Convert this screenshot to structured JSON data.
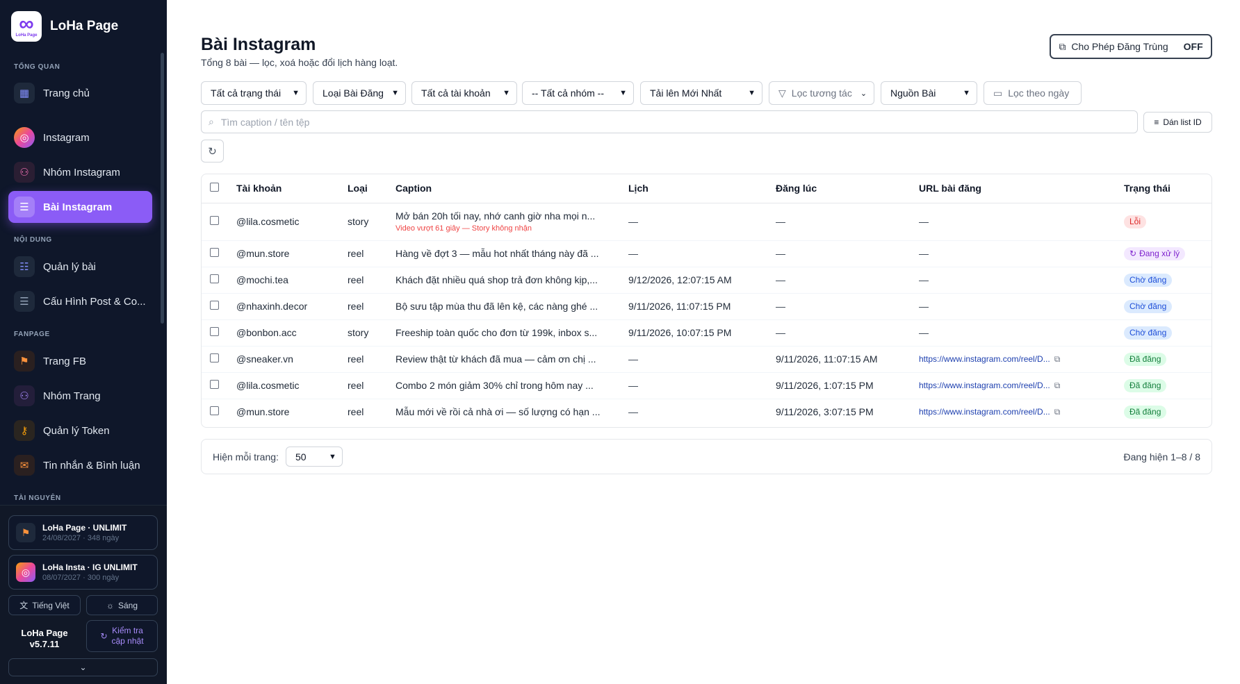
{
  "brand": {
    "name": "LoHa Page",
    "logo_text": "LoHa Page"
  },
  "sidebar": {
    "sections": {
      "overview": "TỔNG QUAN",
      "content": "NỘI DUNG",
      "fanpage": "FANPAGE",
      "resources": "TÀI NGUYÊN"
    },
    "items": [
      {
        "label": "Trang chủ",
        "icon": "grid-icon"
      },
      {
        "label": "Instagram",
        "icon": "instagram-icon"
      },
      {
        "label": "Nhóm Instagram",
        "icon": "users-icon"
      },
      {
        "label": "Bài Instagram",
        "icon": "list-icon",
        "active": true
      },
      {
        "label": "Quản lý bài",
        "icon": "checklist-icon"
      },
      {
        "label": "Cấu Hình Post & Co...",
        "icon": "sliders-icon"
      },
      {
        "label": "Trang FB",
        "icon": "flag-icon"
      },
      {
        "label": "Nhóm Trang",
        "icon": "users-icon"
      },
      {
        "label": "Quản lý Token",
        "icon": "key-icon"
      },
      {
        "label": "Tin nhắn & Bình luận",
        "icon": "chat-icon"
      }
    ],
    "licenses": [
      {
        "title": "LoHa Page · UNLIMIT",
        "sub": "24/08/2027 · 348 ngày"
      },
      {
        "title": "LoHa Insta · IG UNLIMIT",
        "sub": "08/07/2027 · 300 ngày"
      }
    ],
    "language_label": "Tiếng Việt",
    "theme_label": "Sáng",
    "version_name": "LoHa Page",
    "version_number": "v5.7.11",
    "update_label_1": "Kiểm tra",
    "update_label_2": "cập nhật"
  },
  "header": {
    "title": "Bài Instagram",
    "subtitle": "Tổng 8 bài — lọc, xoá hoặc đổi lịch hàng loạt.",
    "dup_label": "Cho Phép Đăng Trùng",
    "dup_state": "OFF"
  },
  "filters": {
    "status": "Tất cả trạng thái",
    "post_type": "Loại Bài Đăng",
    "account": "Tất cả tài khoản",
    "group": "-- Tất cả nhóm --",
    "sort": "Tải lên Mới Nhất",
    "interaction": "Lọc tương tác",
    "source": "Nguồn Bài",
    "date": "Lọc theo ngày"
  },
  "search": {
    "placeholder": "Tìm caption / tên tệp",
    "paste_label": "Dán list ID"
  },
  "table": {
    "headers": [
      "Tài khoản",
      "Loại",
      "Caption",
      "Lịch",
      "Đăng lúc",
      "URL bài đăng",
      "Trạng thái"
    ],
    "rows": [
      {
        "account": "@lila.cosmetic",
        "type": "story",
        "caption": "Mở bán 20h tối nay, nhớ canh giờ nha mọi n...",
        "error": "Video vượt 61 giây — Story không nhận",
        "schedule": "—",
        "posted": "—",
        "url": "—",
        "status": "Lỗi",
        "status_kind": "error"
      },
      {
        "account": "@mun.store",
        "type": "reel",
        "caption": "Hàng về đợt 3 — mẫu hot nhất tháng này đã ...",
        "schedule": "—",
        "posted": "—",
        "url": "—",
        "status": "Đang xử lý",
        "status_kind": "proc"
      },
      {
        "account": "@mochi.tea",
        "type": "reel",
        "caption": "Khách đặt nhiều quá shop trả đơn không kịp,...",
        "schedule": "9/12/2026, 12:07:15 AM",
        "posted": "—",
        "url": "—",
        "status": "Chờ đăng",
        "status_kind": "wait"
      },
      {
        "account": "@nhaxinh.decor",
        "type": "reel",
        "caption": "Bộ sưu tập mùa thu đã lên kệ, các nàng ghé ...",
        "schedule": "9/11/2026, 11:07:15 PM",
        "posted": "—",
        "url": "—",
        "status": "Chờ đăng",
        "status_kind": "wait"
      },
      {
        "account": "@bonbon.acc",
        "type": "story",
        "caption": "Freeship toàn quốc cho đơn từ 199k, inbox s...",
        "schedule": "9/11/2026, 10:07:15 PM",
        "posted": "—",
        "url": "—",
        "status": "Chờ đăng",
        "status_kind": "wait"
      },
      {
        "account": "@sneaker.vn",
        "type": "reel",
        "caption": "Review thật từ khách đã mua — cảm ơn chị ...",
        "schedule": "—",
        "posted": "9/11/2026, 11:07:15 AM",
        "url": "https://www.instagram.com/reel/D...",
        "status": "Đã đăng",
        "status_kind": "done"
      },
      {
        "account": "@lila.cosmetic",
        "type": "reel",
        "caption": "Combo 2 món giảm 30% chỉ trong hôm nay ...",
        "schedule": "—",
        "posted": "9/11/2026, 1:07:15 PM",
        "url": "https://www.instagram.com/reel/D...",
        "status": "Đã đăng",
        "status_kind": "done"
      },
      {
        "account": "@mun.store",
        "type": "reel",
        "caption": "Mẫu mới về rồi cả nhà ơi — số lượng có hạn ...",
        "schedule": "—",
        "posted": "9/11/2026, 3:07:15 PM",
        "url": "https://www.instagram.com/reel/D...",
        "status": "Đã đăng",
        "status_kind": "done"
      }
    ]
  },
  "pager": {
    "per_page_label": "Hiện mỗi trang:",
    "per_page_value": "50",
    "info": "Đang hiện 1–8 / 8"
  }
}
